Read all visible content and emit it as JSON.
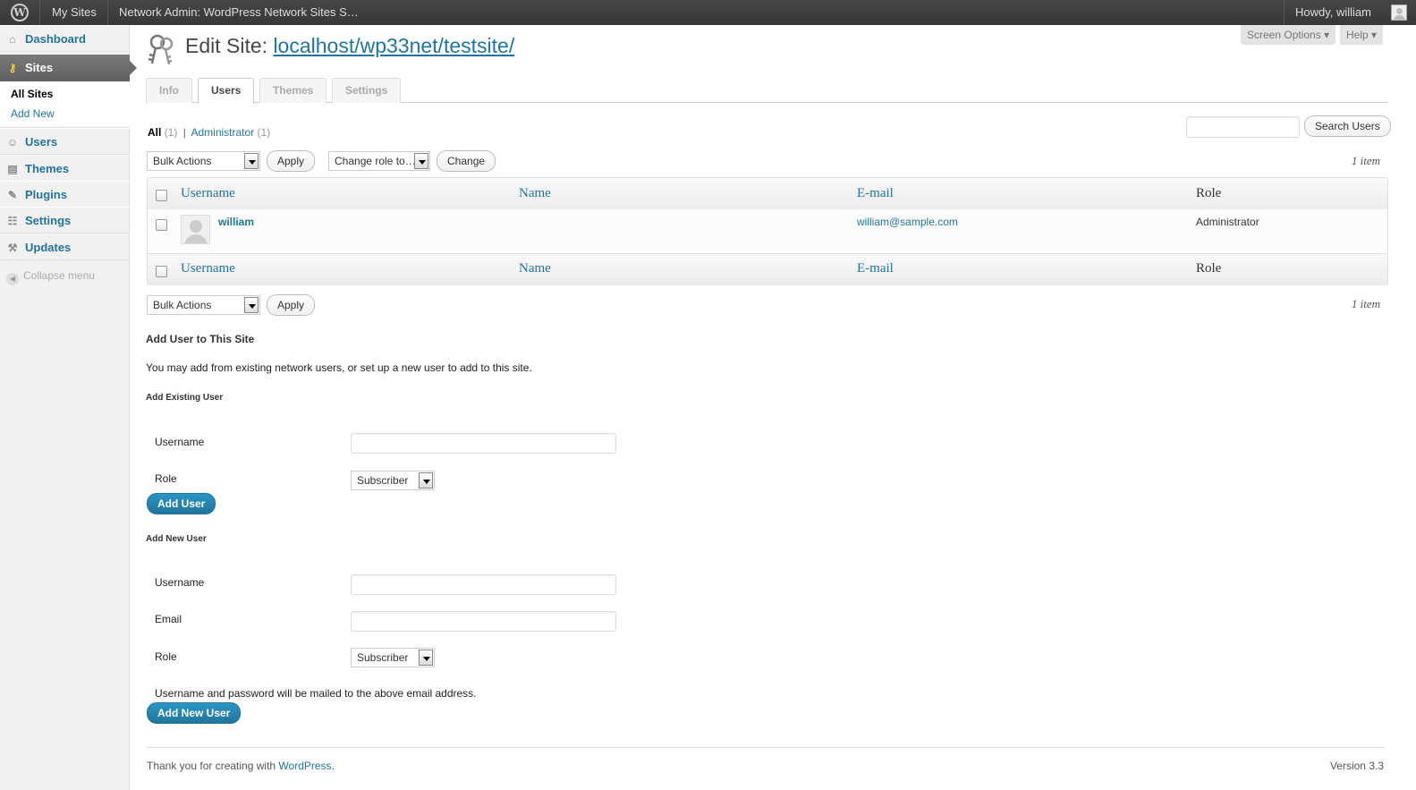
{
  "adminbar": {
    "my_sites": "My Sites",
    "site_name": "Network Admin: WordPress Network Sites S…",
    "howdy": "Howdy, william"
  },
  "sidebar": {
    "dashboard": "Dashboard",
    "sites": "Sites",
    "sub_all_sites": "All Sites",
    "sub_add_new": "Add New",
    "users": "Users",
    "themes": "Themes",
    "plugins": "Plugins",
    "settings": "Settings",
    "updates": "Updates",
    "collapse": "Collapse menu"
  },
  "meta": {
    "screen_options": "Screen Options",
    "help": "Help"
  },
  "page": {
    "title_prefix": "Edit Site:",
    "title_link": "localhost/wp33net/testsite/"
  },
  "tabs": [
    "Info",
    "Users",
    "Themes",
    "Settings"
  ],
  "filters": {
    "all": "All",
    "all_count": "(1)",
    "sep": "|",
    "administrator": "Administrator",
    "administrator_count": "(1)"
  },
  "search": {
    "value": "",
    "button": "Search Users"
  },
  "actions": {
    "bulk_actions": "Bulk Actions",
    "apply": "Apply",
    "change_role": "Change role to…",
    "change": "Change",
    "item_count": "1 item"
  },
  "table": {
    "columns": [
      "Username",
      "Name",
      "E-mail",
      "Role"
    ],
    "rows": [
      {
        "username": "william",
        "name": "",
        "email": "william@sample.com",
        "role": "Administrator"
      }
    ]
  },
  "add_user": {
    "heading": "Add User to This Site",
    "description": "You may add from existing network users, or set up a new user to add to this site.",
    "existing_heading": "Add Existing User",
    "username_label": "Username",
    "role_label": "Role",
    "role_value": "Subscriber",
    "add_button": "Add User",
    "new_heading": "Add New User",
    "email_label": "Email",
    "note": "Username and password will be mailed to the above email address.",
    "add_new_button": "Add New User"
  },
  "footer": {
    "thanks_prefix": "Thank you for creating with",
    "wordpress_link": "WordPress",
    "thanks_suffix": ".",
    "version": "Version 3.3"
  }
}
